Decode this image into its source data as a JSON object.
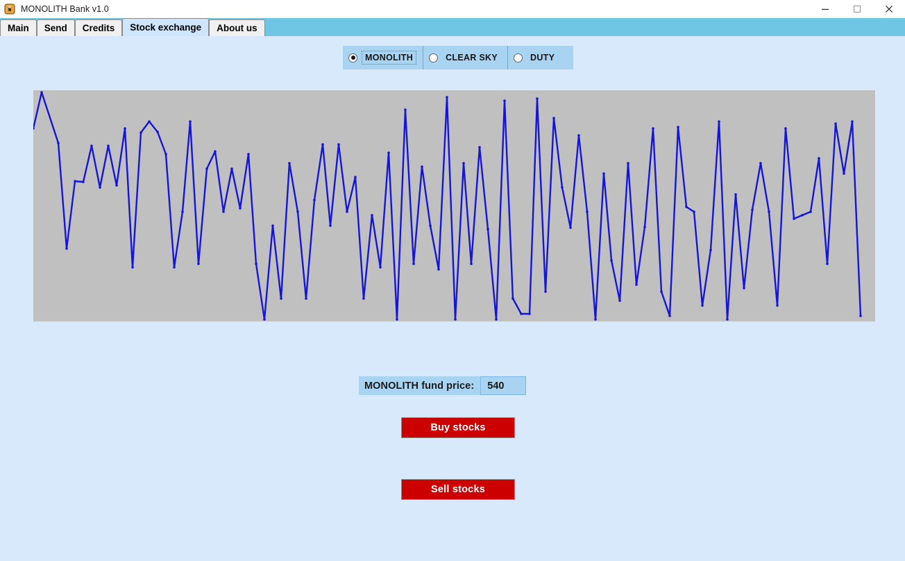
{
  "window": {
    "title": "MONOLITH Bank v1.0",
    "icon": "app-icon",
    "controls": {
      "minimize": "minimize-icon",
      "maximize": "maximize-icon",
      "close": "close-icon"
    }
  },
  "tabs": [
    {
      "label": "Main",
      "selected": false
    },
    {
      "label": "Send",
      "selected": false
    },
    {
      "label": "Credits",
      "selected": false
    },
    {
      "label": "Stock exchange",
      "selected": true
    },
    {
      "label": "About us",
      "selected": false
    }
  ],
  "fund_selector": {
    "options": [
      {
        "label": "MONOLITH",
        "checked": true
      },
      {
        "label": "CLEAR SKY",
        "checked": false
      },
      {
        "label": "DUTY",
        "checked": false
      }
    ]
  },
  "price": {
    "label": "MONOLITH fund price:",
    "value": "540"
  },
  "actions": {
    "buy_label": "Buy stocks",
    "sell_label": "Sell stocks"
  },
  "colors": {
    "page_background": "#d7e9fb",
    "tabstrip": "#6ec6e4",
    "tab_selected": "#cfe5fb",
    "tab_normal": "#f0f0f0",
    "panel_blue": "#a8d4f2",
    "chart_background": "#c0c0c0",
    "chart_line": "#1414dc",
    "button_red": "#cc0000",
    "button_text": "#ffffff"
  },
  "chart_data": {
    "type": "line",
    "title": "",
    "xlabel": "",
    "ylabel": "",
    "grid": false,
    "legend": "none",
    "line_color": "#1414dc",
    "marker": "dot",
    "plot_background": "#c0c0c0",
    "xlim": [
      0,
      1213
    ],
    "ylim": [
      0,
      333
    ],
    "note": "Stock price history for the selected fund, plotted as pixel coordinates inside the 1213x333 plot box. y is measured downward from the plot top edge; smaller y = higher price.",
    "points": [
      [
        0,
        55
      ],
      [
        12,
        3
      ],
      [
        36,
        76
      ],
      [
        48,
        228
      ],
      [
        60,
        131
      ],
      [
        72,
        132
      ],
      [
        84,
        80
      ],
      [
        96,
        140
      ],
      [
        108,
        80
      ],
      [
        120,
        137
      ],
      [
        132,
        55
      ],
      [
        143,
        255
      ],
      [
        155,
        61
      ],
      [
        167,
        45
      ],
      [
        179,
        60
      ],
      [
        191,
        92
      ],
      [
        203,
        255
      ],
      [
        215,
        175
      ],
      [
        226,
        45
      ],
      [
        238,
        250
      ],
      [
        250,
        113
      ],
      [
        262,
        88
      ],
      [
        274,
        175
      ],
      [
        286,
        113
      ],
      [
        298,
        170
      ],
      [
        310,
        92
      ],
      [
        321,
        250
      ],
      [
        333,
        330
      ],
      [
        345,
        195
      ],
      [
        357,
        300
      ],
      [
        369,
        105
      ],
      [
        381,
        175
      ],
      [
        393,
        300
      ],
      [
        405,
        158
      ],
      [
        417,
        78
      ],
      [
        428,
        195
      ],
      [
        440,
        78
      ],
      [
        452,
        175
      ],
      [
        464,
        125
      ],
      [
        476,
        300
      ],
      [
        488,
        180
      ],
      [
        500,
        255
      ],
      [
        512,
        90
      ],
      [
        524,
        330
      ],
      [
        536,
        28
      ],
      [
        548,
        250
      ],
      [
        560,
        110
      ],
      [
        572,
        195
      ],
      [
        584,
        258
      ],
      [
        596,
        10
      ],
      [
        608,
        330
      ],
      [
        620,
        105
      ],
      [
        631,
        250
      ],
      [
        643,
        82
      ],
      [
        655,
        200
      ],
      [
        667,
        330
      ],
      [
        679,
        15
      ],
      [
        691,
        300
      ],
      [
        703,
        322
      ],
      [
        715,
        322
      ],
      [
        726,
        12
      ],
      [
        738,
        290
      ],
      [
        750,
        40
      ],
      [
        762,
        140
      ],
      [
        774,
        198
      ],
      [
        786,
        65
      ],
      [
        798,
        175
      ],
      [
        810,
        330
      ],
      [
        822,
        120
      ],
      [
        833,
        245
      ],
      [
        845,
        303
      ],
      [
        857,
        105
      ],
      [
        869,
        280
      ],
      [
        881,
        197
      ],
      [
        893,
        55
      ],
      [
        905,
        290
      ],
      [
        917,
        325
      ],
      [
        929,
        53
      ],
      [
        941,
        168
      ],
      [
        952,
        175
      ],
      [
        964,
        310
      ],
      [
        976,
        230
      ],
      [
        988,
        45
      ],
      [
        1000,
        330
      ],
      [
        1012,
        150
      ],
      [
        1024,
        285
      ],
      [
        1036,
        172
      ],
      [
        1048,
        105
      ],
      [
        1060,
        175
      ],
      [
        1072,
        310
      ],
      [
        1084,
        55
      ],
      [
        1096,
        185
      ],
      [
        1108,
        180
      ],
      [
        1120,
        175
      ],
      [
        1132,
        98
      ],
      [
        1144,
        250
      ],
      [
        1156,
        48
      ],
      [
        1168,
        120
      ],
      [
        1180,
        45
      ],
      [
        1192,
        325
      ]
    ]
  }
}
